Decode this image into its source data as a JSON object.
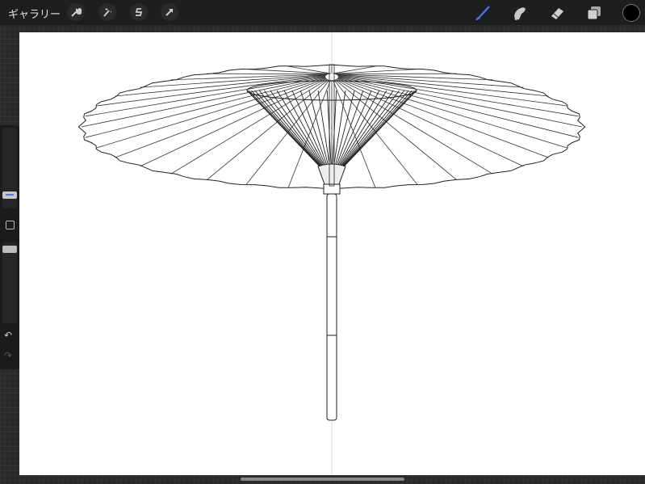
{
  "topbar": {
    "gallery_label": "ギャラリー",
    "left_tools": [
      "wrench-icon",
      "magic-wand-icon",
      "selection-icon",
      "transform-arrow-icon"
    ],
    "right_tools": [
      "brush-icon",
      "smudge-icon",
      "eraser-icon",
      "layers-icon"
    ],
    "active_tool": "brush",
    "accent": "#3b7bf5",
    "current_color": "#000000"
  },
  "sidebar": {
    "brush_size": 0.15,
    "opacity": 0.92,
    "undo_icon": "undo-icon",
    "redo_icon": "redo-icon"
  }
}
